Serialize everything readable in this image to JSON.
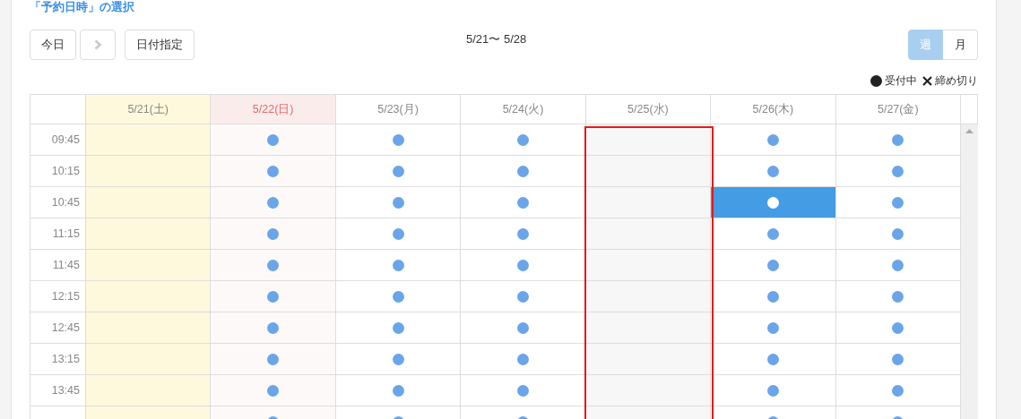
{
  "section_title": "「予約日時」の選択",
  "toolbar": {
    "today_button": "今日",
    "next_button": {
      "disabled": true
    },
    "date_button": "日付指定",
    "range": "5/21〜 5/28",
    "view_tabs": [
      {
        "label": "週",
        "selected": true
      },
      {
        "label": "月",
        "selected": false
      }
    ]
  },
  "legend": [
    {
      "kind": "open",
      "label": "受付中"
    },
    {
      "kind": "closed",
      "label": "締め切り"
    }
  ],
  "columns": [
    {
      "label": "5/21(土)",
      "kind": "saturday",
      "highlighted": false
    },
    {
      "label": "5/22(日)",
      "kind": "sunday",
      "highlighted": false
    },
    {
      "label": "5/23(月)",
      "kind": "weekday",
      "highlighted": false
    },
    {
      "label": "5/24(火)",
      "kind": "weekday",
      "highlighted": false
    },
    {
      "label": "5/25(水)",
      "kind": "blocked",
      "highlighted": true
    },
    {
      "label": "5/26(木)",
      "kind": "weekday",
      "highlighted": false
    },
    {
      "label": "5/27(金)",
      "kind": "weekday",
      "highlighted": false
    }
  ],
  "rows": [
    {
      "time": "09:45",
      "slots": [
        {
          "open": false,
          "selected": false
        },
        {
          "open": true,
          "selected": false
        },
        {
          "open": true,
          "selected": false
        },
        {
          "open": true,
          "selected": false
        },
        {
          "open": false,
          "selected": false
        },
        {
          "open": true,
          "selected": false
        },
        {
          "open": true,
          "selected": false
        }
      ]
    },
    {
      "time": "10:15",
      "slots": [
        {
          "open": false,
          "selected": false
        },
        {
          "open": true,
          "selected": false
        },
        {
          "open": true,
          "selected": false
        },
        {
          "open": true,
          "selected": false
        },
        {
          "open": false,
          "selected": false
        },
        {
          "open": true,
          "selected": false
        },
        {
          "open": true,
          "selected": false
        }
      ]
    },
    {
      "time": "10:45",
      "slots": [
        {
          "open": false,
          "selected": false
        },
        {
          "open": true,
          "selected": false
        },
        {
          "open": true,
          "selected": false
        },
        {
          "open": true,
          "selected": false
        },
        {
          "open": false,
          "selected": false
        },
        {
          "open": true,
          "selected": true
        },
        {
          "open": true,
          "selected": false
        }
      ]
    },
    {
      "time": "11:15",
      "slots": [
        {
          "open": false,
          "selected": false
        },
        {
          "open": true,
          "selected": false
        },
        {
          "open": true,
          "selected": false
        },
        {
          "open": true,
          "selected": false
        },
        {
          "open": false,
          "selected": false
        },
        {
          "open": true,
          "selected": false
        },
        {
          "open": true,
          "selected": false
        }
      ]
    },
    {
      "time": "11:45",
      "slots": [
        {
          "open": false,
          "selected": false
        },
        {
          "open": true,
          "selected": false
        },
        {
          "open": true,
          "selected": false
        },
        {
          "open": true,
          "selected": false
        },
        {
          "open": false,
          "selected": false
        },
        {
          "open": true,
          "selected": false
        },
        {
          "open": true,
          "selected": false
        }
      ]
    },
    {
      "time": "12:15",
      "slots": [
        {
          "open": false,
          "selected": false
        },
        {
          "open": true,
          "selected": false
        },
        {
          "open": true,
          "selected": false
        },
        {
          "open": true,
          "selected": false
        },
        {
          "open": false,
          "selected": false
        },
        {
          "open": true,
          "selected": false
        },
        {
          "open": true,
          "selected": false
        }
      ]
    },
    {
      "time": "12:45",
      "slots": [
        {
          "open": false,
          "selected": false
        },
        {
          "open": true,
          "selected": false
        },
        {
          "open": true,
          "selected": false
        },
        {
          "open": true,
          "selected": false
        },
        {
          "open": false,
          "selected": false
        },
        {
          "open": true,
          "selected": false
        },
        {
          "open": true,
          "selected": false
        }
      ]
    },
    {
      "time": "13:15",
      "slots": [
        {
          "open": false,
          "selected": false
        },
        {
          "open": true,
          "selected": false
        },
        {
          "open": true,
          "selected": false
        },
        {
          "open": true,
          "selected": false
        },
        {
          "open": false,
          "selected": false
        },
        {
          "open": true,
          "selected": false
        },
        {
          "open": true,
          "selected": false
        }
      ]
    },
    {
      "time": "13:45",
      "slots": [
        {
          "open": false,
          "selected": false
        },
        {
          "open": true,
          "selected": false
        },
        {
          "open": true,
          "selected": false
        },
        {
          "open": true,
          "selected": false
        },
        {
          "open": false,
          "selected": false
        },
        {
          "open": true,
          "selected": false
        },
        {
          "open": true,
          "selected": false
        }
      ]
    },
    {
      "slots": [
        {
          "open": false,
          "selected": false
        },
        {
          "open": true,
          "selected": false
        },
        {
          "open": true,
          "selected": false
        },
        {
          "open": true,
          "selected": false
        },
        {
          "open": false,
          "selected": false
        },
        {
          "open": true,
          "selected": false
        },
        {
          "open": true,
          "selected": false
        }
      ]
    }
  ]
}
